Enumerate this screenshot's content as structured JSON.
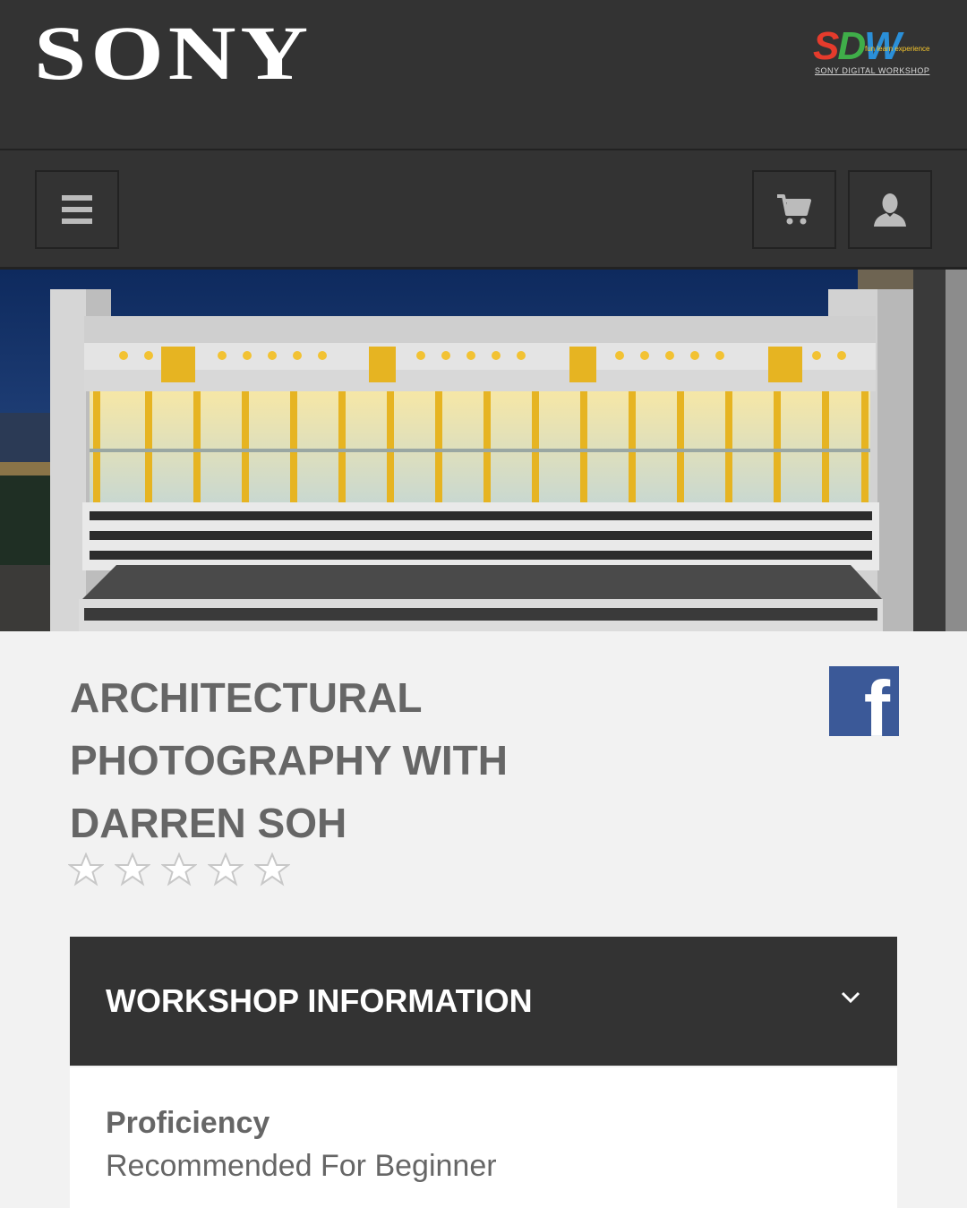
{
  "header": {
    "brand": "SONY",
    "partner_logo": {
      "letters": [
        "S",
        "D",
        "W"
      ],
      "tagline": "fun learn experience",
      "subtitle": "SONY DIGITAL WORKSHOP",
      "colors": {
        "s": "#e53b2c",
        "d": "#3fae49",
        "w": "#2a8fd8"
      }
    }
  },
  "nav": {
    "menu_icon": "hamburger-menu-icon",
    "cart_icon": "shopping-cart-icon",
    "account_icon": "user-account-icon"
  },
  "hero": {
    "image": "architectural-building-night-photo"
  },
  "workshop": {
    "title_lines": [
      "ARCHITECTURAL",
      "PHOTOGRAPHY WITH",
      "DARREN SOH"
    ],
    "share_icon": "facebook-icon",
    "share_label": "f",
    "rating": {
      "value": 0,
      "max": 5
    }
  },
  "accordion": {
    "title": "WORKSHOP INFORMATION",
    "expanded": true,
    "fields": [
      {
        "label": "Proficiency",
        "value": "Recommended For Beginner"
      }
    ]
  },
  "colors": {
    "header_bg": "#333333",
    "page_bg": "#f2f2f2",
    "text_grey": "#666666",
    "facebook": "#3b5998"
  }
}
